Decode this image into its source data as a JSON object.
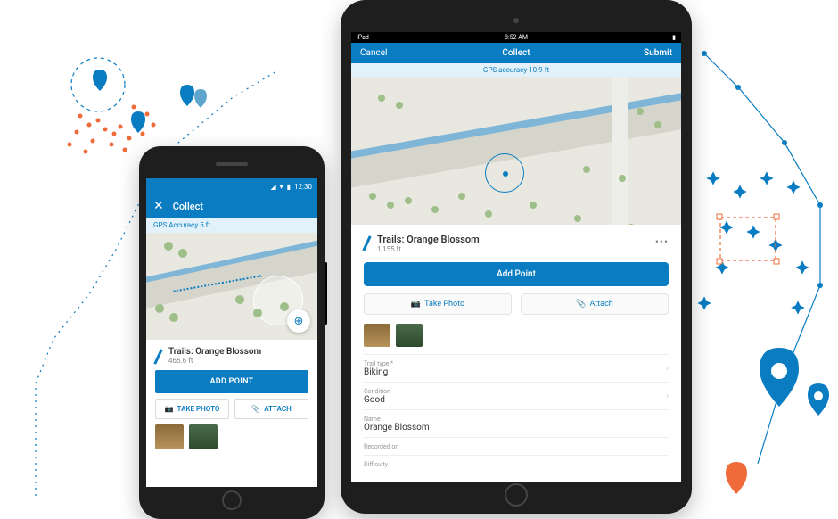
{
  "phone": {
    "status_time": "12:30",
    "header_title": "Collect",
    "gps_text": "GPS Accuracy 5 ft",
    "feature_title": "Trails: Orange Blossom",
    "feature_sub": "465.6 ft",
    "add_point": "ADD POINT",
    "take_photo": "TAKE PHOTO",
    "attach": "ATTACH"
  },
  "tablet": {
    "status_time": "8:52 AM",
    "cancel": "Cancel",
    "header_title": "Collect",
    "submit": "Submit",
    "gps_text": "GPS accuracy 10.9 ft",
    "feature_title": "Trails: Orange Blossom",
    "feature_sub": "1,155 ft",
    "add_point": "Add Point",
    "take_photo": "Take Photo",
    "attach": "Attach",
    "fields": [
      {
        "label": "Trail type *",
        "value": "Biking"
      },
      {
        "label": "Condition",
        "value": "Good"
      },
      {
        "label": "Name",
        "value": "Orange Blossom"
      },
      {
        "label": "Recorded on",
        "value": ""
      },
      {
        "label": "Difficulty",
        "value": ""
      }
    ]
  },
  "colors": {
    "primary": "#0a7cc1",
    "orange": "#ef6b3a"
  }
}
